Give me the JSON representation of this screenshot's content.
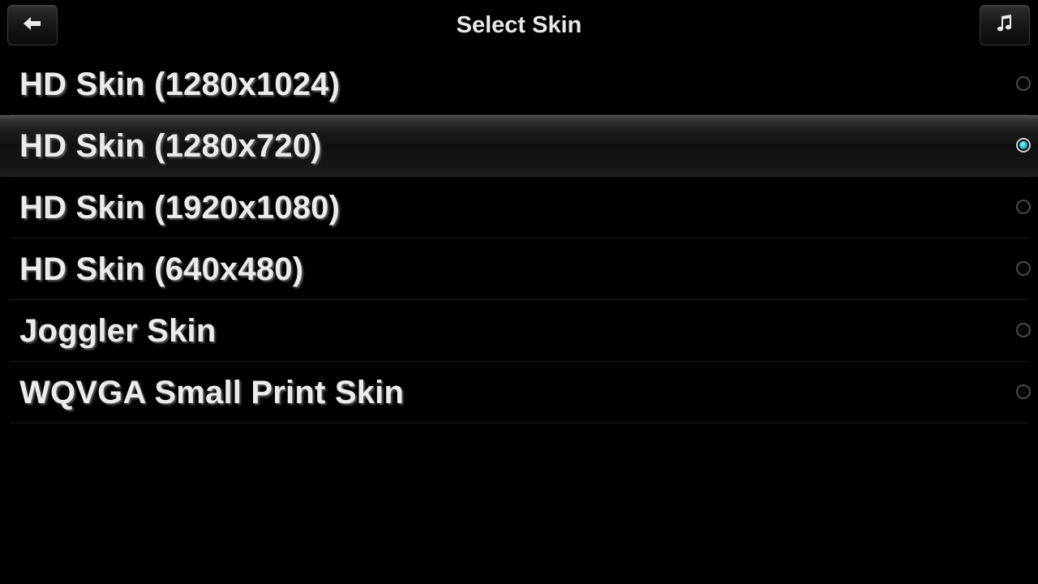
{
  "header": {
    "title": "Select Skin",
    "back_icon": "back-arrow-icon",
    "music_icon": "music-note-icon"
  },
  "skins": [
    {
      "label": "HD Skin (1280x1024)",
      "selected": false
    },
    {
      "label": "HD Skin (1280x720)",
      "selected": true
    },
    {
      "label": "HD Skin (1920x1080)",
      "selected": false
    },
    {
      "label": "HD Skin (640x480)",
      "selected": false
    },
    {
      "label": "Joggler Skin",
      "selected": false
    },
    {
      "label": "WQVGA Small Print Skin",
      "selected": false
    }
  ],
  "colors": {
    "background": "#000000",
    "text": "#ebebeb",
    "radio_selected": "#1bb9c9"
  }
}
